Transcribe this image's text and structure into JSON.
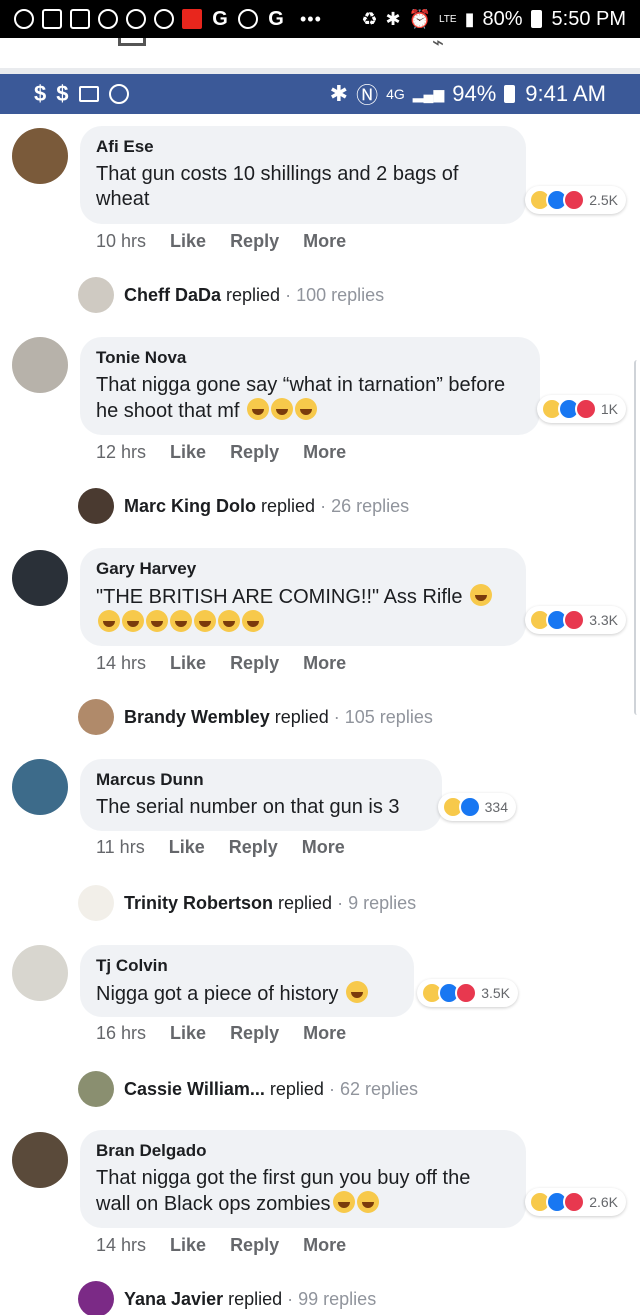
{
  "outer_status": {
    "battery": "80%",
    "time": "5:50 PM",
    "network": "LTE"
  },
  "fb_status": {
    "battery": "94%",
    "time": "9:41 AM",
    "network": "4G"
  },
  "comments": [
    {
      "author": "Afi Ese",
      "text": "That gun costs 10 shillings and 2 bags of wheat",
      "reaction_count": "2.5K",
      "time": "10 hrs",
      "actions": {
        "like": "Like",
        "reply": "Reply",
        "more": "More"
      },
      "replied_name": "Cheff DaDa",
      "replied_word": "replied",
      "replies": "100 replies",
      "avatar_color": "#7a5a3a"
    },
    {
      "author": "Tonie Nova",
      "text": "That nigga gone say “what in tarnation” before he shoot that mf",
      "reaction_count": "1K",
      "time": "12 hrs",
      "actions": {
        "like": "Like",
        "reply": "Reply",
        "more": "More"
      },
      "replied_name": "Marc King Dolo",
      "replied_word": "replied",
      "replies": "26 replies",
      "avatar_color": "#b7b2aa"
    },
    {
      "author": "Gary Harvey",
      "text": "\"THE BRITISH ARE COMING!!\" Ass Rifle",
      "reaction_count": "3.3K",
      "time": "14 hrs",
      "actions": {
        "like": "Like",
        "reply": "Reply",
        "more": "More"
      },
      "replied_name": "Brandy Wembley",
      "replied_word": "replied",
      "replies": "105 replies",
      "avatar_color": "#2a3038"
    },
    {
      "author": "Marcus Dunn",
      "text": "The serial number on that gun is 3",
      "reaction_count": "334",
      "time": "11 hrs",
      "actions": {
        "like": "Like",
        "reply": "Reply",
        "more": "More"
      },
      "replied_name": "Trinity Robertson",
      "replied_word": "replied",
      "replies": "9 replies",
      "avatar_color": "#3d6b8a"
    },
    {
      "author": "Tj Colvin",
      "text": "Nigga got a piece of history",
      "reaction_count": "3.5K",
      "time": "16 hrs",
      "actions": {
        "like": "Like",
        "reply": "Reply",
        "more": "More"
      },
      "replied_name": "Cassie William...",
      "replied_word": "replied",
      "replies": "62 replies",
      "avatar_color": "#d8d6cf"
    },
    {
      "author": "Bran Delgado",
      "text": "That nigga got the first gun you buy off the wall on Black ops zombies",
      "reaction_count": "2.6K",
      "time": "14 hrs",
      "actions": {
        "like": "Like",
        "reply": "Reply",
        "more": "More"
      },
      "replied_name": "Yana Javier",
      "replied_word": "replied",
      "replies": "99 replies",
      "avatar_color": "#5a4a3a"
    }
  ],
  "colors": {
    "fb_blue": "#3b5998",
    "bubble": "#f0f2f5",
    "meta_text": "#65676b",
    "haha": "#f7c94b",
    "like": "#1877f2",
    "love": "#e8384f"
  }
}
